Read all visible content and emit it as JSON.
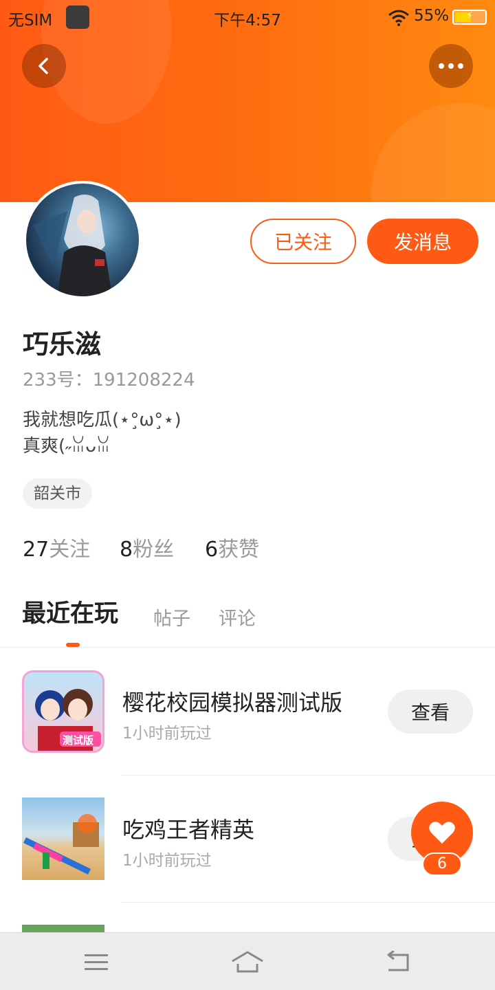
{
  "status_bar": {
    "carrier": "无SIM",
    "time": "下午4:57",
    "battery_percent": "55%",
    "battery_level": 0.55
  },
  "header": {
    "back_icon": "chevron-left-icon",
    "more_icon": "more-dots-icon",
    "gradient_colors": [
      "#ff5a14",
      "#ff8a10"
    ]
  },
  "profile": {
    "username": "巧乐滋",
    "uid": "233号：191208224",
    "bio_line1": "我就想吃瓜(⋆°̧ω°̧⋆)",
    "bio_line2": "真爽(˶ꈍᴗꈍ",
    "location": "韶关市",
    "follow_label": "已关注",
    "message_label": "发消息",
    "stats": [
      {
        "num": "27",
        "label": "关注"
      },
      {
        "num": "8",
        "label": "粉丝"
      },
      {
        "num": "6",
        "label": "获赞"
      }
    ]
  },
  "tabs": [
    {
      "label": "最近在玩",
      "active": true
    },
    {
      "label": "帖子",
      "active": false
    },
    {
      "label": "评论",
      "active": false
    }
  ],
  "games": [
    {
      "name": "樱花校园模拟器测试版",
      "time": "1小时前玩过",
      "button": "查看",
      "icon_text": "测试版"
    },
    {
      "name": "吃鸡王者精英",
      "time": "1小时前玩过",
      "button": "查看"
    }
  ],
  "like_fab": {
    "icon": "heart-icon",
    "count": "6"
  },
  "nav": {
    "items": [
      "menu-icon",
      "home-icon",
      "back-icon"
    ]
  },
  "accent_color": "#ff5a14"
}
